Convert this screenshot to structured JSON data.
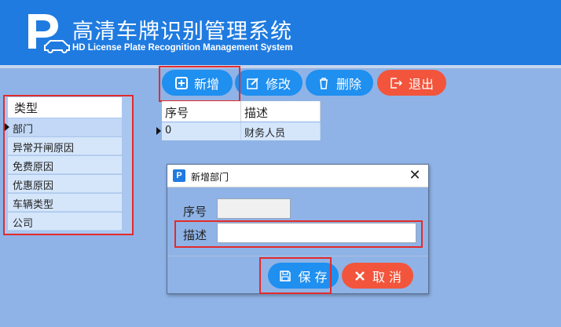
{
  "header": {
    "logo_letter": "P",
    "title": "高清车牌识别管理系统",
    "subtitle": "HD License Plate Recognition Management System"
  },
  "toolbar": {
    "add_label": "新增",
    "edit_label": "修改",
    "delete_label": "删除",
    "exit_label": "退出"
  },
  "categories": {
    "header": "类型",
    "items": [
      {
        "label": "部门"
      },
      {
        "label": "异常开闸原因"
      },
      {
        "label": "免费原因"
      },
      {
        "label": "优惠原因"
      },
      {
        "label": "车辆类型"
      },
      {
        "label": "公司"
      }
    ]
  },
  "grid": {
    "columns": [
      "序号",
      "描述"
    ],
    "rows": [
      [
        "0",
        "财务人员"
      ]
    ]
  },
  "dialog": {
    "icon_letter": "P",
    "title": "新增部门",
    "close_glyph": "✕",
    "seq_label": "序号",
    "seq_value": "",
    "desc_label": "描述",
    "desc_value": "",
    "save_label": "保 存",
    "cancel_label": "取 消"
  },
  "colors": {
    "header_bg": "#1f7be0",
    "page_bg": "#8fb3e6",
    "button_blue": "#1f8ff0",
    "button_red": "#f2553c",
    "highlight_box": "#e32b2b"
  }
}
